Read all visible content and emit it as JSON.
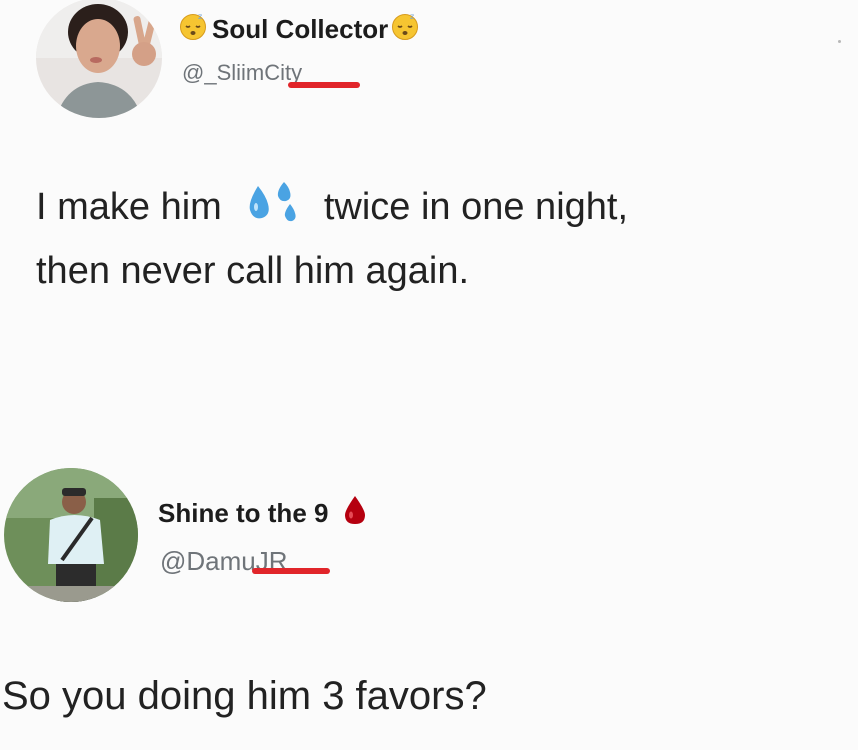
{
  "tweets": [
    {
      "display_name": "Soul Collector",
      "handle": "@_SliimCity",
      "text_line1_before": "I make him",
      "text_line1_after": "twice in one night,",
      "text_line2": "then never call him again.",
      "name_emoji": "sleeping-face-icon",
      "inline_emoji": "sweat-droplets-icon",
      "handle_redaction_color": "#e1252a"
    },
    {
      "display_name": "Shine to the 9",
      "handle": "@DamuJR",
      "text": "So you doing him 3 favors?",
      "name_emoji": "blood-drop-icon",
      "handle_redaction_color": "#e1252a"
    }
  ]
}
